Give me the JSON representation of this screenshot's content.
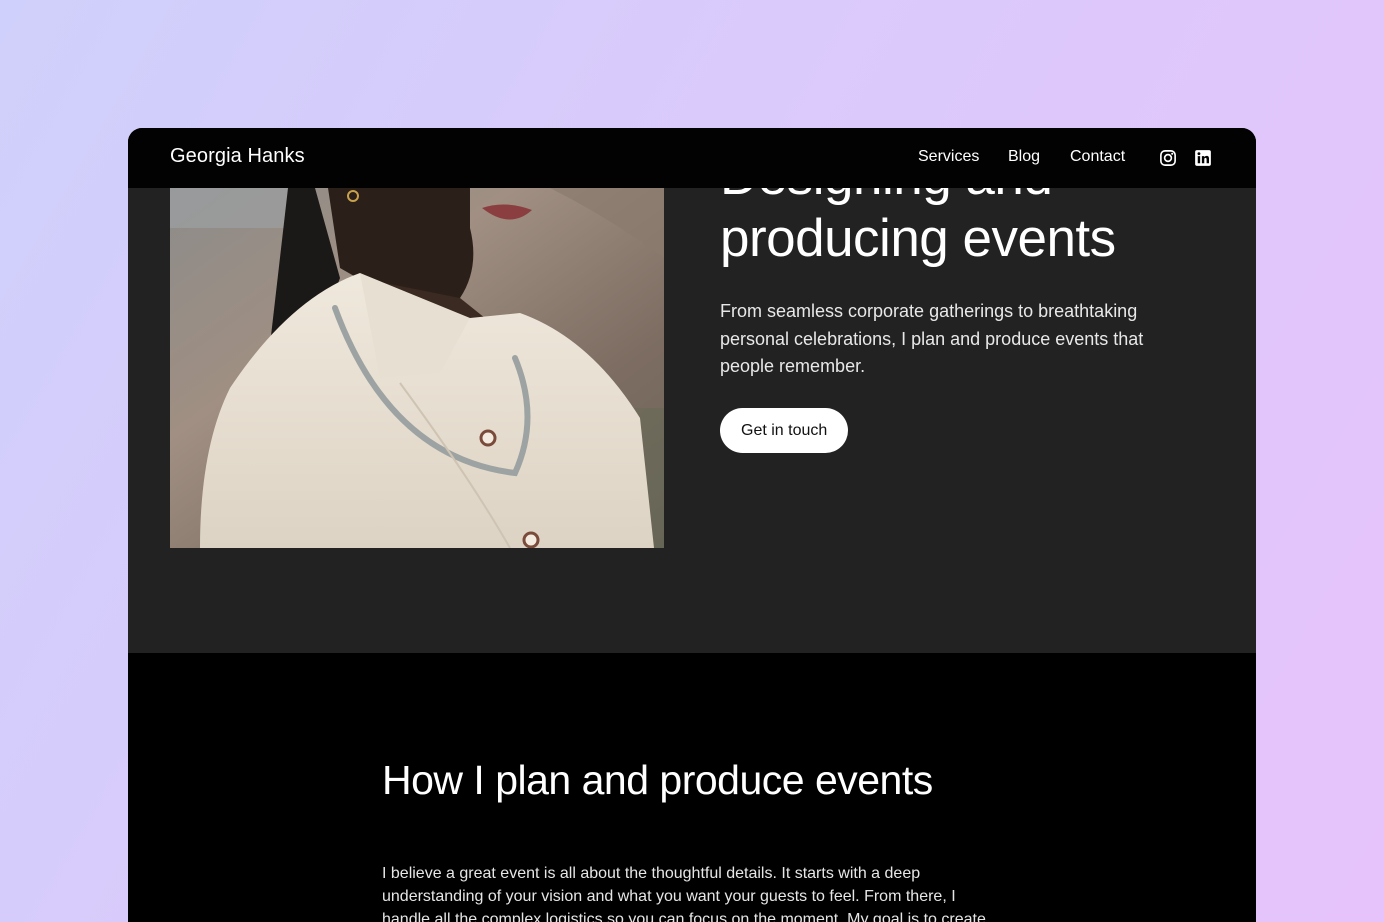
{
  "header": {
    "brand": "Georgia Hanks",
    "nav": [
      "Services",
      "Blog",
      "Contact"
    ],
    "social_icons": [
      "instagram-icon",
      "linkedin-icon"
    ]
  },
  "hero": {
    "title_line1": "Designing and",
    "title_line2": "producing events",
    "description": "From seamless corporate gatherings to breathtaking personal celebrations, I plan and produce events that people remember.",
    "cta_label": "Get in touch"
  },
  "process": {
    "title": "How I plan and produce events",
    "body": "I believe a great event is all about the thoughtful details. It starts with a deep understanding of your vision and what you want your guests to feel. From there, I handle all the complex logistics so you can focus on the moment. My goal is to create"
  },
  "colors": {
    "page_gradient": [
      "#cfd0fb",
      "#e6c3fb"
    ],
    "nav_bar": "#020202",
    "hero_bg": "#222222",
    "section_bg": "#000000",
    "button_bg": "#ffffff"
  }
}
